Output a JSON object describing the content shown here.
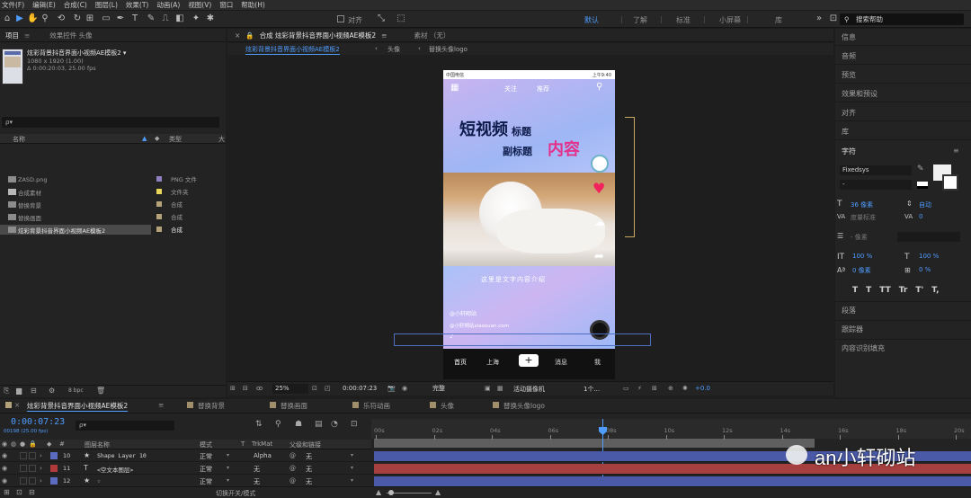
{
  "menu": [
    "文件(F)",
    "编辑(E)",
    "合成(C)",
    "图层(L)",
    "效果(T)",
    "动画(A)",
    "视图(V)",
    "窗口",
    "帮助(H)"
  ],
  "toolbar": {
    "snap_label": "对齐",
    "workspaces": [
      {
        "label": "默认",
        "active": true
      },
      {
        "label": "了解",
        "active": false
      },
      {
        "label": "标准",
        "active": false
      },
      {
        "label": "小屏幕",
        "active": false
      },
      {
        "label": "库",
        "active": false
      }
    ],
    "search_label": "搜索帮助"
  },
  "project": {
    "tab_project": "项目",
    "tab_effects": "效果控件 头像",
    "comp_name": "炫彩背景抖音界面小视频AE模板2 ▾",
    "comp_info1": "1080 x 1920 (1.00)",
    "comp_info2": "Δ 0:00:20:03, 25.00 fps",
    "search_placeholder": "ρ▾",
    "col_name": "名称",
    "col_type": "类型",
    "items": [
      {
        "name": "ZASD.png",
        "type": "PNG 文件",
        "color": "#8f7fbf"
      },
      {
        "name": "合成素材",
        "type": "文件夹",
        "color": "#e8d65a"
      },
      {
        "name": "替换背景",
        "type": "合成",
        "color": "#b4a27a"
      },
      {
        "name": "替换画面",
        "type": "合成",
        "color": "#b4a27a"
      },
      {
        "name": "炫彩背景抖音界面小视频AE模板2",
        "type": "合成",
        "color": "#b4a27a"
      }
    ],
    "bpc": "8 bpc"
  },
  "viewer": {
    "tab_label": "合成 炫彩背景抖音界面小视频AE模板2",
    "material_label": "素材 （无）",
    "breadcrumb": [
      "炫彩背景抖音界面小视频AE模板2",
      "头像",
      "替换头像logo"
    ],
    "phone": {
      "carrier": "中国电信",
      "time": "上午9:40",
      "top_tabs": [
        "关注",
        "推荐"
      ],
      "title_main": "短视频",
      "title_small": "标题",
      "subtitle_small": "副标题",
      "subtitle_big": "内容",
      "caption": "这里是文字内容介绍",
      "handle": "@小轩砌站",
      "site": "@小轩砌站xiaoxuan.com",
      "bottom_nav": [
        "首页",
        "上海",
        "+",
        "消息",
        "我"
      ]
    },
    "zoom": "25%",
    "timecode": "0:00:07:23",
    "quality": "完整",
    "camera": "活动摄像机",
    "views": "1个...",
    "exposure": "+0.0"
  },
  "right_panel": {
    "items": [
      "信息",
      "音频",
      "预览",
      "效果和预设",
      "对齐",
      "库"
    ],
    "char_title": "字符",
    "font": "Fixedsys",
    "size": "36 像素",
    "leading": "自动",
    "tracking_label": "度量标准",
    "tracking": "0",
    "stroke": "- 像素",
    "vscale": "100 %",
    "hscale": "100 %",
    "baseline": "0 像素",
    "tsume": "0 %",
    "styles": [
      "T",
      "T",
      "TT",
      "Tr",
      "T'",
      "T,"
    ],
    "more": [
      "段落",
      "跟踪器",
      "内容识别填充"
    ]
  },
  "timeline": {
    "tabs": [
      {
        "label": "炫彩背景抖音界面小视频AE模板2",
        "active": true
      },
      {
        "label": "替换背景",
        "active": false
      },
      {
        "label": "替换画面",
        "active": false
      },
      {
        "label": "乐符动画",
        "active": false
      },
      {
        "label": "头像",
        "active": false
      },
      {
        "label": "替换头像logo",
        "active": false
      }
    ],
    "timecode": "0:00:07:23",
    "timecode_sub": "00198 (25.00 fps)",
    "search_placeholder": "ρ▾",
    "col_layer": "图层名称",
    "col_mode": "模式",
    "col_t": "T",
    "col_trkmat": "TrkMat",
    "col_parent": "父级和链接",
    "ruler": [
      "00s",
      "02s",
      "04s",
      "06s",
      "08s",
      "10s",
      "12s",
      "14s",
      "16s",
      "18s",
      "20s"
    ],
    "layers": [
      {
        "num": "10",
        "type": "★",
        "name": "Shape Layer 10",
        "mode": "正常",
        "trkmat": "Alpha",
        "parent": "无",
        "color": "#5b6cc0"
      },
      {
        "num": "11",
        "type": "T",
        "name": "<空文本图层>",
        "mode": "正常",
        "trkmat": "无",
        "parent": "无",
        "color": "#b03a3a"
      },
      {
        "num": "12",
        "type": "★",
        "name": "☆",
        "mode": "正常",
        "trkmat": "无",
        "parent": "无",
        "color": "#5b6cc0"
      }
    ],
    "toggle_label": "切换开关/模式",
    "watermark": "an小轩砌站"
  }
}
